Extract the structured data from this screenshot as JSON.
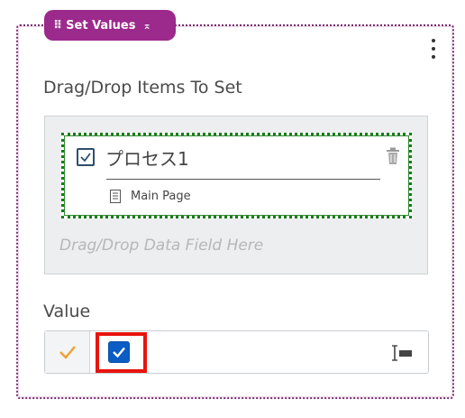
{
  "panel": {
    "tag_label": "Set Values",
    "section_label": "Drag/Drop Items To Set",
    "drop_hint": "Drag/Drop Data Field Here",
    "value_label": "Value"
  },
  "item": {
    "title": "プロセス1",
    "page_label": "Main Page",
    "checked": true
  },
  "value": {
    "checked": true
  },
  "colors": {
    "tag_bg": "#9b2a8c",
    "panel_border": "#7b2d72",
    "item_border": "#1a7a1a",
    "highlight": "#e8140f",
    "checkbox": "#0b5cc4",
    "prefix_check": "#f0a030"
  },
  "icons": {
    "grip": "drag-handle-icon",
    "collapse": "collapse-icon",
    "menu": "more-vertical-icon",
    "trash": "trash-icon",
    "page": "page-icon",
    "field_type": "text-cursor-icon"
  }
}
